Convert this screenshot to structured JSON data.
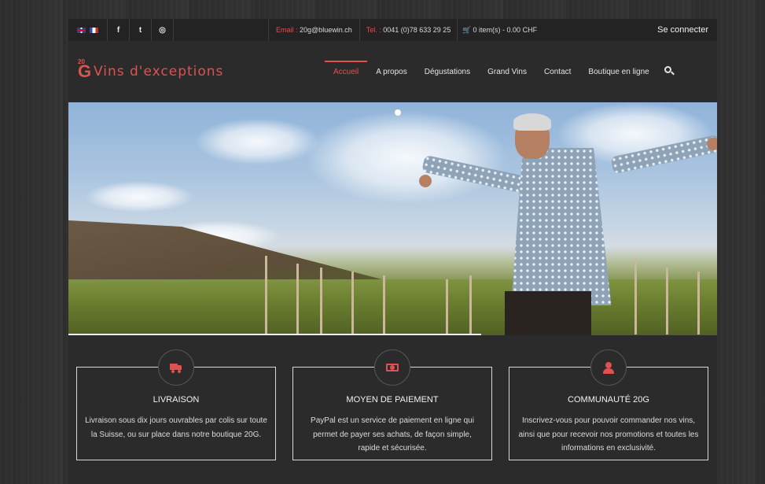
{
  "topbar": {
    "email_label": "Email :",
    "email_value": "20g@bluewin.ch",
    "tel_label": "Tel. :",
    "tel_value": "0041 (0)78 633 29 25",
    "cart_text": "0 item(s) - 0.00 CHF",
    "login": "Se connecter",
    "social": {
      "facebook": "f",
      "twitter": "t",
      "instagram": "◎"
    },
    "icons": [
      "uk-flag-icon",
      "fr-flag-icon",
      "facebook-icon",
      "twitter-icon",
      "instagram-icon",
      "cart-icon"
    ]
  },
  "header": {
    "logo_small": "20",
    "logo_g": "G",
    "logo_text": "Vins d'exceptions",
    "nav": [
      "Accueil",
      "A propos",
      "Dégustations",
      "Grand Vins",
      "Contact",
      "Boutique en ligne"
    ],
    "active_nav": "Accueil"
  },
  "features": [
    {
      "title": "LIVRAISON",
      "text": "Livraison sous dix jours ouvrables par colis sur toute la Suisse, ou sur place dans notre boutique 20G.",
      "icon": "truck-icon"
    },
    {
      "title": "MOYEN DE PAIEMENT",
      "text": "PayPal est un service de paiement en ligne qui permet de payer ses achats, de façon simple, rapide et sécurisée.",
      "icon": "money-icon"
    },
    {
      "title": "COMMUNAUTÉ 20G",
      "text": "Inscrivez-vous pour pouvoir commander nos vins, ainsi que pour recevoir nos promotions et toutes les informations en exclusivité.",
      "icon": "user-icon"
    }
  ],
  "colors": {
    "accent": "#e0524f",
    "background": "#2b2b2b",
    "topbar": "#232323"
  }
}
